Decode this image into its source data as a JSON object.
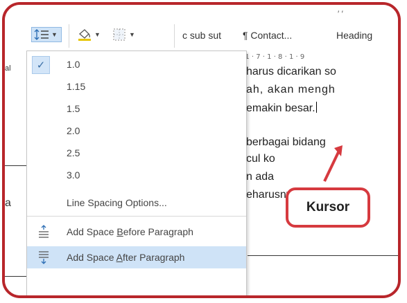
{
  "ribbon": {
    "line_spacing_icon": "line-spacing-icon",
    "shading_icon": "paint-bucket-icon",
    "borders_icon": "borders-icon",
    "styles": [
      "c sub sut",
      "¶ Contact...",
      "Heading"
    ],
    "top_marks": "′ ′"
  },
  "menu": {
    "items": [
      {
        "label": "1.0",
        "checked": true
      },
      {
        "label": "1.15"
      },
      {
        "label": "1.5"
      },
      {
        "label": "2.0"
      },
      {
        "label": "2.5"
      },
      {
        "label": "3.0"
      }
    ],
    "options_label": "Line Spacing Options...",
    "before": {
      "pre": "Add Space ",
      "key": "B",
      "post": "efore Paragraph"
    },
    "after": {
      "pre": "Add Space ",
      "key": "A",
      "post": "fter Paragraph"
    }
  },
  "document": {
    "ruler": "· 1 · 7 · 1 · 8 · 1 · 9",
    "lines": [
      "harus dicarikan so",
      "ah, akan mengh",
      "emakin besar.",
      "berbagai bidang",
      "cul ko",
      "n ada",
      "eharusnya  dan"
    ],
    "left_chars": [
      "al",
      "a"
    ]
  },
  "callout": {
    "label": "Kursor"
  },
  "colors": {
    "frame": "#b8262b",
    "callout": "#d63a3f",
    "highlight": "#cfe3f7"
  }
}
